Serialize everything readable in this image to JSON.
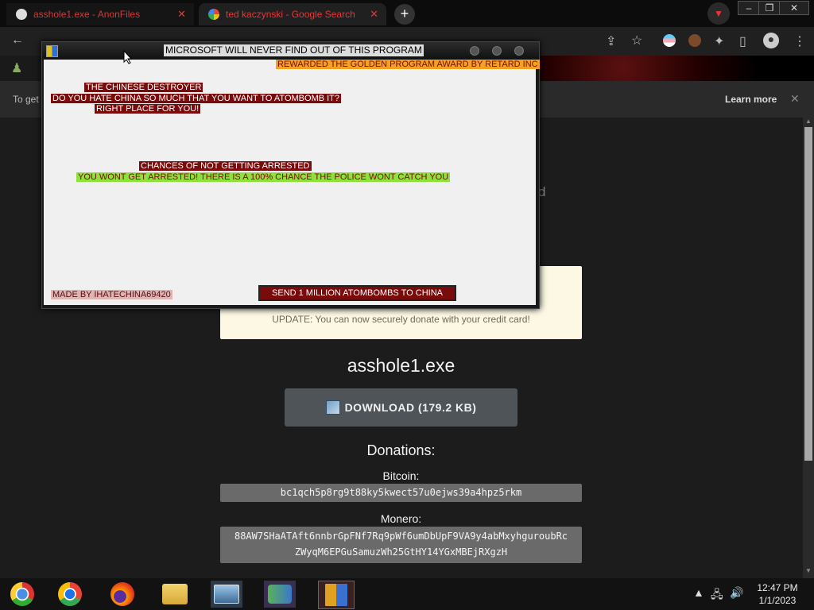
{
  "browser": {
    "tabs": [
      {
        "label": "asshole1.exe - AnonFiles",
        "active": false
      },
      {
        "label": "ted kaczynski - Google Search",
        "active": true
      }
    ],
    "new_tab_label": "+",
    "window_controls": [
      "–",
      "❐",
      "✕"
    ]
  },
  "infobar": {
    "text": "To get",
    "learn_more": "Learn more",
    "close": "✕"
  },
  "page": {
    "bg_fragment": "d",
    "notice_update": "UPDATE: You can now securely donate with your credit card!",
    "file_name": "asshole1.exe",
    "download_label": "DOWNLOAD (179.2 KB)",
    "donations_title": "Donations:",
    "bitcoin_label": "Bitcoin:",
    "bitcoin_address": "bc1qch5p8rg9t88ky5kwect57u0ejws39a4hpz5rkm",
    "monero_label": "Monero:",
    "monero_address_line1": "88AW7SHaATAft6nnbrGpFNf7Rq9pWf6umDbUpF9VA9y4abMxyhguroubRc",
    "monero_address_line2": "ZWyqM6EPGuSamuzWh25GtHY14YGxMBEjRXgzH"
  },
  "popup": {
    "title": "MICROSOFT WILL NEVER FIND OUT OF THIS PROGRAM",
    "award": "REWARDED THE GOLDEN PROGRAM AWARD BY RETARD INC",
    "heading1": "THE CHINESE DESTROYER",
    "line1": "DO YOU HATE CHINA SO MUCH THAT YOU WANT TO ATOMBOMB IT?",
    "line2": "RIGHT PLACE FOR YOU!",
    "heading2": "CHANCES OF NOT GETTING ARRESTED",
    "result": "YOU WONT GET ARRESTED! THERE IS A 100% CHANCE THE POLICE WONT CATCH YOU",
    "credit": "MADE BY IHATECHINA69420",
    "send_button": "SEND 1 MILLION ATOMBOMBS TO CHINA"
  },
  "taskbar": {
    "items": [
      "chrome-classic",
      "chrome",
      "firefox",
      "file-explorer",
      "photo-viewer",
      "people-app",
      "red-app"
    ],
    "time": "12:47 PM",
    "date": "1/1/2023"
  }
}
